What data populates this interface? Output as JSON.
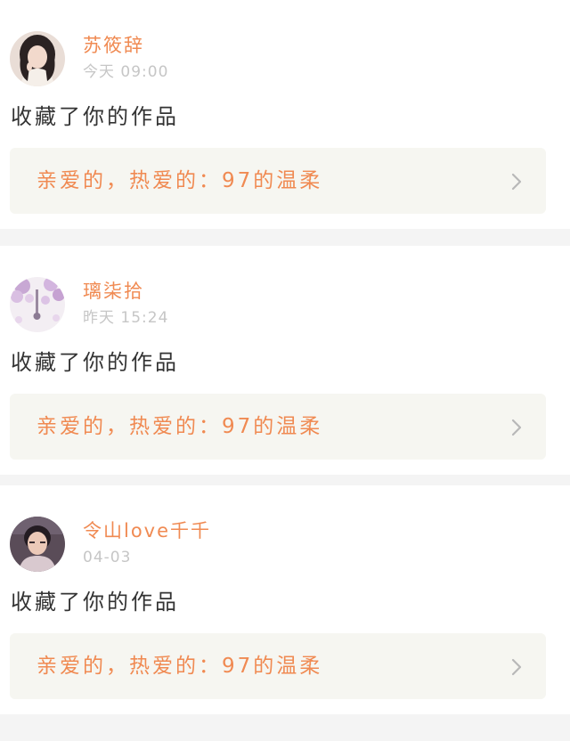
{
  "feed": {
    "items": [
      {
        "username": "苏筱辞",
        "timestamp": "今天  09:00",
        "action": "收藏了你的作品",
        "work_title": "亲爱的，热爱的：97的温柔",
        "avatar_icon": "user-avatar-girl-icon"
      },
      {
        "username": "璃柒拾",
        "timestamp": "昨天  15:24",
        "action": "收藏了你的作品",
        "work_title": "亲爱的，热爱的：97的温柔",
        "avatar_icon": "user-avatar-wisteria-icon"
      },
      {
        "username": "令山love千千",
        "timestamp": "04-03",
        "action": "收藏了你的作品",
        "work_title": "亲爱的，热爱的：97的温柔",
        "avatar_icon": "user-avatar-boy-icon"
      }
    ]
  },
  "colors": {
    "accent": "#f08a52",
    "timestamp": "#c6c6c6",
    "text": "#333333",
    "link_bg": "#f6f6f1",
    "separator": "#f4f4f4"
  }
}
